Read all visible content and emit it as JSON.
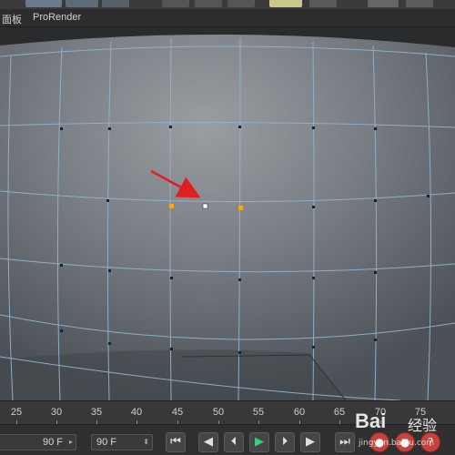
{
  "menubar": {
    "items": [
      "面板",
      "ProRender"
    ]
  },
  "viewport": {
    "description_colors": {
      "edge": "#8fb3cc",
      "selected_point": "#ffffff",
      "neighbor_point": "#f5a623",
      "arrow": "#e02020"
    }
  },
  "timeline": {
    "ticks": [
      "25",
      "30",
      "35",
      "40",
      "45",
      "50",
      "55",
      "60",
      "65",
      "70",
      "75"
    ]
  },
  "transport": {
    "start_frame": "90 F",
    "end_frame": "90 F",
    "buttons": [
      "go-to-start",
      "previous-key",
      "previous-frame",
      "play",
      "next-frame",
      "next-key",
      "go-to-end",
      "record",
      "auto-key",
      "keyframe-selection"
    ]
  },
  "watermark": {
    "logo": "Bai",
    "cn": "经验",
    "url": "jingyan.baidu.com"
  }
}
